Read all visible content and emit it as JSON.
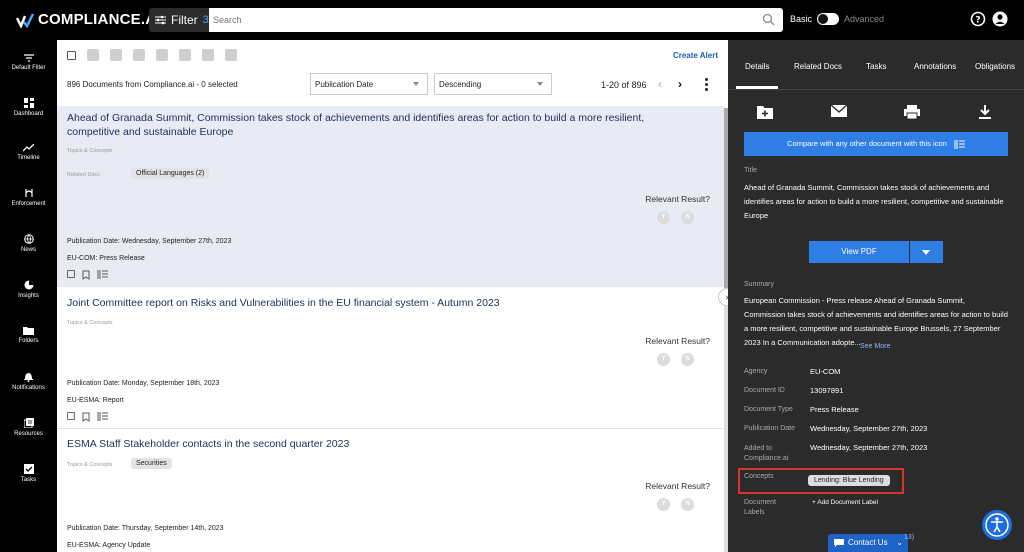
{
  "topbar": {
    "logo_text": "COMPLIANCE.AI",
    "filter_label": "Filter",
    "filter_count": "3",
    "search_placeholder": "Search",
    "mode_basic": "Basic",
    "mode_advanced": "Advanced"
  },
  "leftnav": {
    "items": [
      {
        "label": "Default Filter",
        "icon": "filter-icon"
      },
      {
        "label": "Dashboard",
        "icon": "dashboard-icon"
      },
      {
        "label": "Timeline",
        "icon": "timeline-icon"
      },
      {
        "label": "Enforcement",
        "icon": "enforcement-icon"
      },
      {
        "label": "News",
        "icon": "globe-icon"
      },
      {
        "label": "Insights",
        "icon": "pie-icon"
      },
      {
        "label": "Folders",
        "icon": "folder-icon"
      },
      {
        "label": "Notifications",
        "icon": "bell-icon"
      },
      {
        "label": "Resources",
        "icon": "resources-icon"
      },
      {
        "label": "Tasks",
        "icon": "tasks-icon"
      }
    ]
  },
  "main": {
    "create_alert": "Create Alert",
    "count_text": "896 Documents from Compliance.ai - 0 selected",
    "sort_field": "Publication Date",
    "sort_order": "Descending",
    "pager": "1-20 of 896",
    "documents": [
      {
        "title": "Ahead of Granada Summit, Commission takes stock of achievements and identifies areas for action to build a more resilient, competitive and sustainable Europe",
        "topics": "Topics & Concepts",
        "related_label": "Related Docs",
        "related_chip": "Official Languages (2)",
        "relevant": "Relevant Result?",
        "pub_date": "Publication Date: Wednesday, September 27th, 2023",
        "agency_line": "EU-COM:  Press Release"
      },
      {
        "title": "Joint Committee report on Risks and Vulnerabilities in the EU financial system - Autumn 2023",
        "topics": "Topics & Concepts",
        "relevant": "Relevant Result?",
        "pub_date": "Publication Date: Monday, September 18th, 2023",
        "agency_line": "EU-ESMA:  Report"
      },
      {
        "title": "ESMA Staff Stakeholder contacts in the second quarter 2023",
        "topics": "Topics & Concepts",
        "topic_chip": "Securities",
        "relevant": "Relevant Result?",
        "pub_date": "Publication Date: Thursday, September 14th, 2023",
        "agency_line": "EU-ESMA:  Agency Update"
      }
    ],
    "yes": "Y",
    "no": "N"
  },
  "details": {
    "tabs": [
      "Details",
      "Related Docs",
      "Tasks",
      "Annotations",
      "Obligations"
    ],
    "compare_label": "Compare with any other document with this icon",
    "title_label": "Title",
    "title_value": "Ahead of Granada Summit, Commission takes stock of achievements and identifies areas for action to build a more resilient, competitive and sustainable Europe",
    "view_pdf": "View PDF",
    "summary_label": "Summary",
    "summary_value": "European Commission - Press release Ahead of Granada Summit, Commission takes stock of achievements and identifies areas for action to build a more resilient, competitive and sustainable Europe Brussels, 27 September 2023 In a Communication adopte...",
    "see_more": "See More",
    "agency_label": "Agency",
    "agency_value": "EU-COM",
    "docid_label": "Document ID",
    "docid_value": "13097891",
    "doctype_label": "Document Type",
    "doctype_value": "Press Release",
    "pubdate_label": "Publication Date",
    "pubdate_value": "Wednesday, September 27th, 2023",
    "added_label": "Added to Compliance.ai",
    "added_value": "Wednesday, September 27th, 2023",
    "concepts_label": "Concepts",
    "concept_chip": "Lending: Blue Lending",
    "doclabels_label": "Document Labels",
    "add_label": "+ Add Document Label",
    "contact_us": "Contact Us",
    "contact_num": "13)"
  }
}
